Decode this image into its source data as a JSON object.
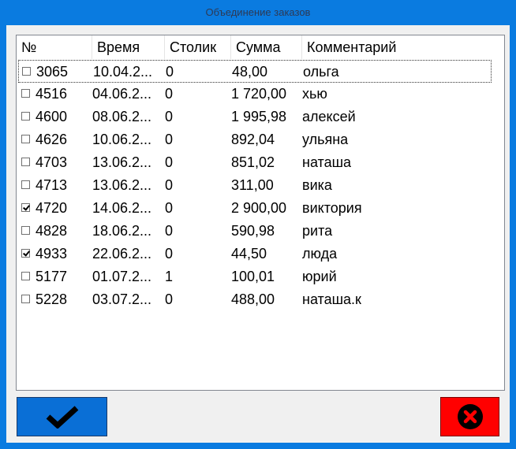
{
  "window": {
    "title": "Объединение заказов"
  },
  "colors": {
    "frame": "#0a7be0",
    "ok_button": "#0a6fd6",
    "cancel_button": "#ff0000"
  },
  "list": {
    "columns": [
      "№",
      "Время",
      "Столик",
      "Сумма",
      "Комментарий"
    ],
    "rows": [
      {
        "checked": false,
        "number": "3065",
        "time": "10.04.2...",
        "table": "0",
        "sum": "48,00",
        "comment": "ольга"
      },
      {
        "checked": false,
        "number": "4516",
        "time": "04.06.2...",
        "table": "0",
        "sum": "1 720,00",
        "comment": "хью"
      },
      {
        "checked": false,
        "number": "4600",
        "time": "08.06.2...",
        "table": "0",
        "sum": "1 995,98",
        "comment": "алексей"
      },
      {
        "checked": false,
        "number": "4626",
        "time": "10.06.2...",
        "table": "0",
        "sum": "892,04",
        "comment": "ульяна"
      },
      {
        "checked": false,
        "number": "4703",
        "time": "13.06.2...",
        "table": "0",
        "sum": "851,02",
        "comment": "наташа"
      },
      {
        "checked": false,
        "number": "4713",
        "time": "13.06.2...",
        "table": "0",
        "sum": "311,00",
        "comment": "вика"
      },
      {
        "checked": true,
        "number": "4720",
        "time": "14.06.2...",
        "table": "0",
        "sum": "2 900,00",
        "comment": "виктория"
      },
      {
        "checked": false,
        "number": "4828",
        "time": "18.06.2...",
        "table": "0",
        "sum": "590,98",
        "comment": "рита"
      },
      {
        "checked": true,
        "number": "4933",
        "time": "22.06.2...",
        "table": "0",
        "sum": "44,50",
        "comment": "люда"
      },
      {
        "checked": false,
        "number": "5177",
        "time": "01.07.2...",
        "table": "1",
        "sum": "100,01",
        "comment": "юрий"
      },
      {
        "checked": false,
        "number": "5228",
        "time": "03.07.2...",
        "table": "0",
        "sum": "488,00",
        "comment": "наташа.к"
      }
    ]
  },
  "buttons": {
    "ok_icon": "checkmark-icon",
    "cancel_icon": "close-circle-icon"
  }
}
